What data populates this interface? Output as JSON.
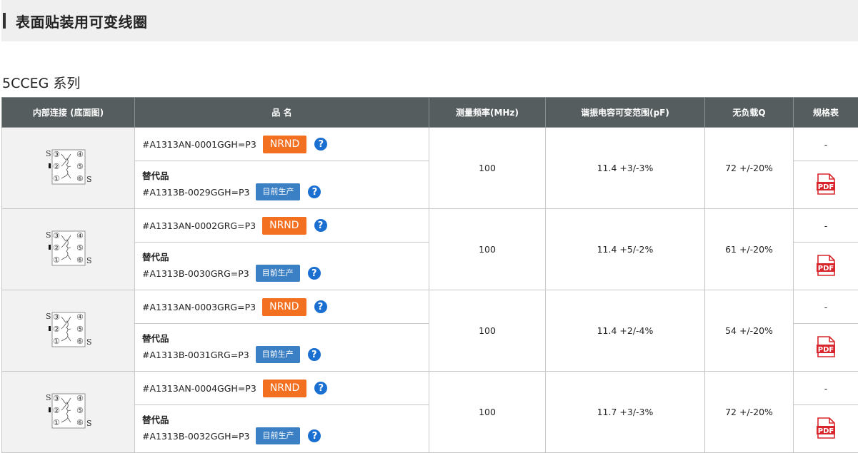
{
  "page": {
    "title": "表面贴装用可变线圈"
  },
  "series": {
    "title": "5CCEG 系列"
  },
  "table": {
    "headers": {
      "connection": "内部连接 (底面图)",
      "part_name": "品 名",
      "freq": "测量频率(MHz)",
      "capacitance": "谐振电容可变范围(pF)",
      "q": "无负载Q",
      "spec": "规格表"
    },
    "diagram_labels": {
      "s": "S",
      "p3": "③",
      "p4": "④",
      "p2": "②",
      "p5": "⑤",
      "p1": "①",
      "p6": "⑥"
    },
    "rows": [
      {
        "part": "#A1313AN-0001GGH=P3",
        "status": "NRND",
        "replace_label": "替代品",
        "replacement": "#A1313B-0029GGH=P3",
        "replacement_status": "目前生产",
        "freq": "100",
        "capacitance": "11.4 +3/-3%",
        "q": "72 +/-20%",
        "spec": "-",
        "pdf": "PDF"
      },
      {
        "part": "#A1313AN-0002GRG=P3",
        "status": "NRND",
        "replace_label": "替代品",
        "replacement": "#A1313B-0030GRG=P3",
        "replacement_status": "目前生产",
        "freq": "100",
        "capacitance": "11.4 +5/-2%",
        "q": "61 +/-20%",
        "spec": "-",
        "pdf": "PDF"
      },
      {
        "part": "#A1313AN-0003GRG=P3",
        "status": "NRND",
        "replace_label": "替代品",
        "replacement": "#A1313B-0031GRG=P3",
        "replacement_status": "目前生产",
        "freq": "100",
        "capacitance": "11.4 +2/-4%",
        "q": "54 +/-20%",
        "spec": "-",
        "pdf": "PDF"
      },
      {
        "part": "#A1313AN-0004GGH=P3",
        "status": "NRND",
        "replace_label": "替代品",
        "replacement": "#A1313B-0032GGH=P3",
        "replacement_status": "目前生产",
        "freq": "100",
        "capacitance": "11.7 +3/-3%",
        "q": "72 +/-20%",
        "spec": "-",
        "pdf": "PDF"
      }
    ],
    "help_glyph": "?"
  },
  "colors": {
    "header_bg": "#565d5e",
    "nrnd": "#f37021",
    "active": "#3b7fc4",
    "help": "#1a6fd1",
    "pdf": "#d9262c"
  },
  "icons": {
    "help": "question-circle-icon",
    "pdf": "pdf-file-icon",
    "diagram": "coil-connection-diagram-icon"
  }
}
